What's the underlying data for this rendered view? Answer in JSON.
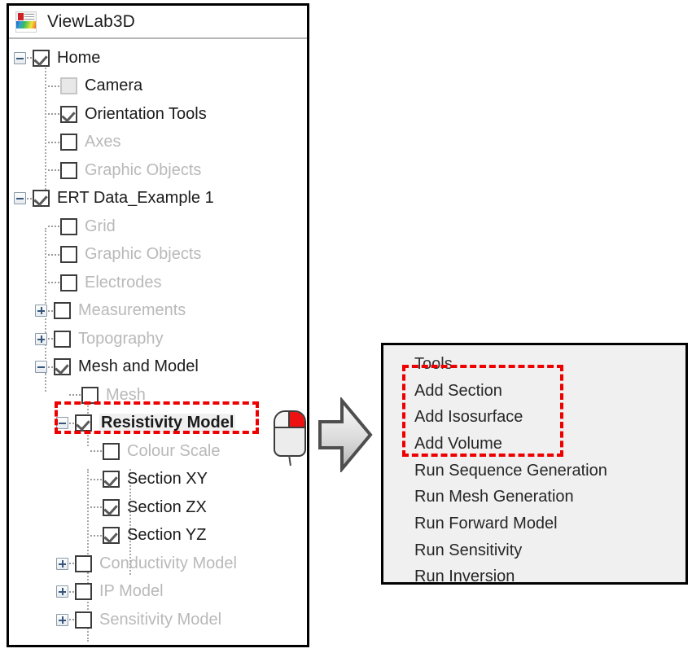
{
  "app": {
    "title": "ViewLab3D",
    "icon": "viewlab3d-app-icon"
  },
  "colors": {
    "highlight_red": "#ee0000",
    "menu_background": "#f0f0f0",
    "panel_border": "#000000",
    "enabled_text": "#1b1b1b",
    "disabled_text": "#b9b9b9",
    "mouse_right_button": "#ee1111"
  },
  "tree": {
    "nodes": [
      {
        "label": "Home",
        "level": 0,
        "expander": "minus",
        "checkbox": "checked",
        "enabled": true,
        "bold": false,
        "selected": false
      },
      {
        "label": "Camera",
        "level": 1,
        "expander": "none",
        "checkbox": "disabled",
        "enabled": true,
        "bold": false,
        "selected": false
      },
      {
        "label": "Orientation Tools",
        "level": 1,
        "expander": "none",
        "checkbox": "checked",
        "enabled": true,
        "bold": false,
        "selected": false
      },
      {
        "label": "Axes",
        "level": 1,
        "expander": "none",
        "checkbox": "unchecked",
        "enabled": false,
        "bold": false,
        "selected": false
      },
      {
        "label": "Graphic Objects",
        "level": 1,
        "expander": "none",
        "checkbox": "unchecked",
        "enabled": false,
        "bold": false,
        "selected": false
      },
      {
        "label": "ERT Data_Example 1",
        "level": 0,
        "expander": "minus",
        "checkbox": "checked",
        "enabled": true,
        "bold": false,
        "selected": false
      },
      {
        "label": "Grid",
        "level": 1,
        "expander": "none",
        "checkbox": "unchecked",
        "enabled": false,
        "bold": false,
        "selected": false
      },
      {
        "label": "Graphic Objects",
        "level": 1,
        "expander": "none",
        "checkbox": "unchecked",
        "enabled": false,
        "bold": false,
        "selected": false
      },
      {
        "label": "Electrodes",
        "level": 1,
        "expander": "none",
        "checkbox": "unchecked",
        "enabled": false,
        "bold": false,
        "selected": false
      },
      {
        "label": "Measurements",
        "level": 1,
        "expander": "plus",
        "checkbox": "unchecked",
        "enabled": false,
        "bold": false,
        "selected": false
      },
      {
        "label": "Topography",
        "level": 1,
        "expander": "plus",
        "checkbox": "unchecked",
        "enabled": false,
        "bold": false,
        "selected": false
      },
      {
        "label": "Mesh and Model",
        "level": 1,
        "expander": "minus",
        "checkbox": "checked",
        "enabled": true,
        "bold": false,
        "selected": false
      },
      {
        "label": "Mesh",
        "level": 2,
        "expander": "none",
        "checkbox": "unchecked",
        "enabled": false,
        "bold": false,
        "selected": false
      },
      {
        "label": "Resistivity Model",
        "level": 2,
        "expander": "minus",
        "checkbox": "checked",
        "enabled": true,
        "bold": true,
        "selected": true
      },
      {
        "label": "Colour Scale",
        "level": 3,
        "expander": "none",
        "checkbox": "unchecked",
        "enabled": false,
        "bold": false,
        "selected": false
      },
      {
        "label": "Section XY",
        "level": 3,
        "expander": "none",
        "checkbox": "checked",
        "enabled": true,
        "bold": false,
        "selected": false
      },
      {
        "label": "Section ZX",
        "level": 3,
        "expander": "none",
        "checkbox": "checked",
        "enabled": true,
        "bold": false,
        "selected": false
      },
      {
        "label": "Section YZ",
        "level": 3,
        "expander": "none",
        "checkbox": "checked",
        "enabled": true,
        "bold": false,
        "selected": false
      },
      {
        "label": "Conductivity Model",
        "level": 2,
        "expander": "plus",
        "checkbox": "unchecked",
        "enabled": false,
        "bold": false,
        "selected": false
      },
      {
        "label": "IP Model",
        "level": 2,
        "expander": "plus",
        "checkbox": "unchecked",
        "enabled": false,
        "bold": false,
        "selected": false
      },
      {
        "label": "Sensitivity Model",
        "level": 2,
        "expander": "plus",
        "checkbox": "unchecked",
        "enabled": false,
        "bold": false,
        "selected": false
      }
    ]
  },
  "context_menu": {
    "header": "Tools",
    "items": [
      {
        "label": "Add Section",
        "highlighted": true
      },
      {
        "label": "Add Isosurface",
        "highlighted": true
      },
      {
        "label": "Add Volume",
        "highlighted": true
      },
      {
        "label": "Run Sequence Generation",
        "highlighted": false
      },
      {
        "label": "Run Mesh Generation",
        "highlighted": false
      },
      {
        "label": "Run Forward Model",
        "highlighted": false
      },
      {
        "label": "Run Sensitivity",
        "highlighted": false
      },
      {
        "label": "Run Inversion",
        "highlighted": false
      }
    ]
  },
  "annotations": {
    "mouse_icon": "right-click-mouse-icon",
    "arrow_icon": "flow-arrow-right-icon",
    "tree_highlight": "resistivity-model-highlight",
    "menu_highlight": "add-tools-highlight"
  }
}
